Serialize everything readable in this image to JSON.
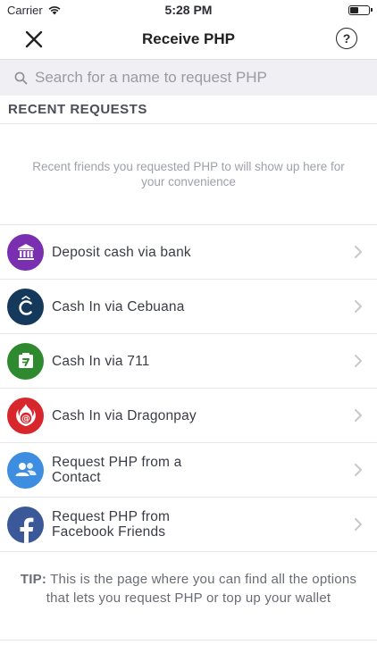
{
  "status_bar": {
    "carrier": "Carrier",
    "time": "5:28 PM"
  },
  "header": {
    "title": "Receive PHP",
    "help_label": "?"
  },
  "search": {
    "placeholder": "Search for a name to request PHP"
  },
  "recent": {
    "heading": "RECENT REQUESTS",
    "empty_message": "Recent friends you requested PHP to will show up here for your convenience"
  },
  "options": [
    {
      "label": "Deposit cash via bank",
      "icon": "bank-icon",
      "color": "#7a2fb0"
    },
    {
      "label": "Cash In via Cebuana",
      "icon": "cebuana-icon",
      "color": "#14395b"
    },
    {
      "label": "Cash In via 711",
      "icon": "store-icon",
      "color": "#2f8a2f"
    },
    {
      "label": "Cash In via Dragonpay",
      "icon": "dragonpay-icon",
      "color": "#d8262d"
    },
    {
      "label": "Request PHP from a Contact",
      "icon": "contacts-icon",
      "color": "#3d8de0"
    },
    {
      "label": "Request PHP from Facebook Friends",
      "icon": "facebook-icon",
      "color": "#3b5998"
    }
  ],
  "tip": {
    "label": "TIP:",
    "text": " This is the page where you can find all the options that lets you request PHP or top up your wallet"
  }
}
